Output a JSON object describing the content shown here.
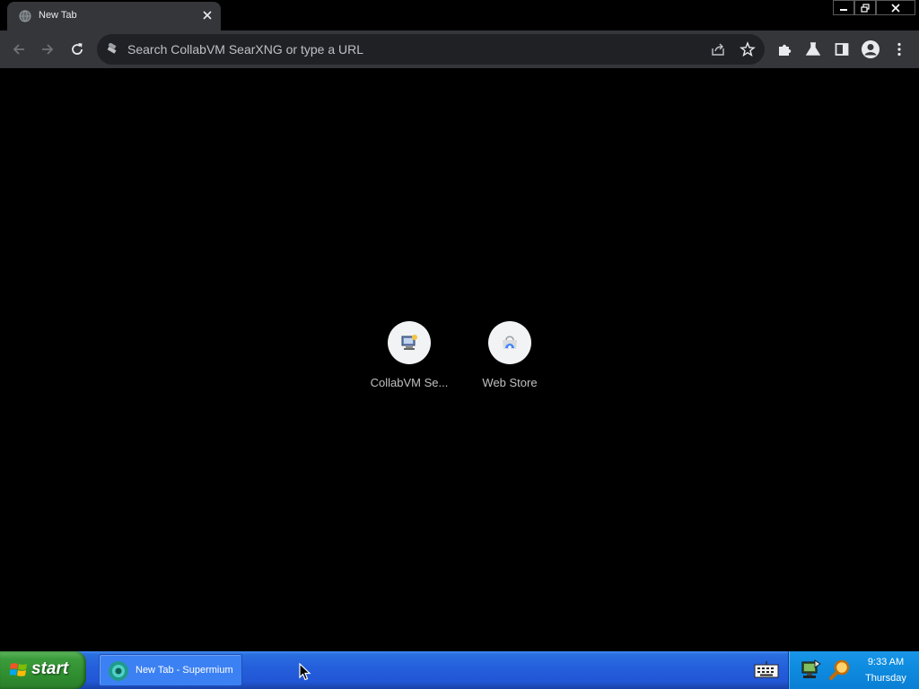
{
  "browser": {
    "tab": {
      "title": "New Tab",
      "favicon": "globe-icon",
      "close_icon": "close-icon"
    },
    "window_controls": [
      "minimize-icon",
      "restore-icon",
      "close-icon"
    ],
    "toolbar": {
      "back_icon": "back-arrow-icon",
      "forward_icon": "forward-arrow-icon",
      "reload_icon": "reload-icon",
      "omnibox_placeholder": "Search CollabVM SearXNG or type a URL",
      "omnibox_value": "",
      "share_icon": "share-icon",
      "bookmark_icon": "star-icon",
      "extensions_icon": "puzzle-icon",
      "labs_icon": "flask-icon",
      "side_panel_icon": "side-panel-icon",
      "profile_icon": "avatar-icon",
      "menu_icon": "kebab-menu-icon"
    }
  },
  "new_tab": {
    "shortcuts": [
      {
        "label": "CollabVM Se...",
        "icon": "collabvm-icon"
      },
      {
        "label": "Web Store",
        "icon": "web-store-icon"
      }
    ]
  },
  "taskbar": {
    "start_label": "start",
    "items": [
      {
        "label": "New Tab - Supermium",
        "icon": "supermium-icon"
      }
    ],
    "tray": {
      "keyboard_icon": "keyboard-icon",
      "icons": [
        "network-icon",
        "search-magnifier-icon"
      ],
      "time": "9:33 AM",
      "day": "Thursday"
    }
  },
  "colors": {
    "toolbar_bg": "#35363a",
    "omnibox_bg": "#202124",
    "page_bg": "#000000",
    "taskbar_blue": "#245edb",
    "start_green": "#3c9c3c",
    "tray_blue": "#0e8ce0"
  }
}
